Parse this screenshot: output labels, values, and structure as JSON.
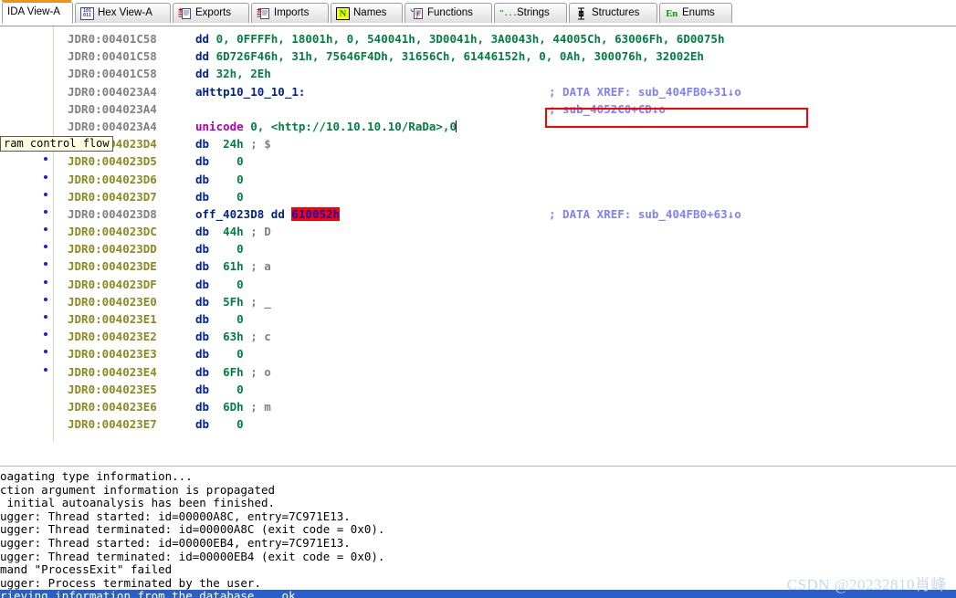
{
  "tabs": [
    {
      "label": "IDA View-A",
      "icon": "none",
      "active": true
    },
    {
      "label": "Hex View-A",
      "icon": "hex-grid-icon",
      "active": false
    },
    {
      "label": "Exports",
      "icon": "export-page-icon",
      "active": false
    },
    {
      "label": "Imports",
      "icon": "import-page-icon",
      "active": false
    },
    {
      "label": "Names",
      "icon": "names-n-icon",
      "active": false
    },
    {
      "label": "Functions",
      "icon": "functions-f-icon",
      "active": false
    },
    {
      "label": "Strings",
      "icon": "strings-quote-icon",
      "active": false
    },
    {
      "label": "Structures",
      "icon": "structures-icon",
      "active": false
    },
    {
      "label": "Enums",
      "icon": "enums-en-icon",
      "active": false
    }
  ],
  "tooltip": {
    "text": "ram control flow"
  },
  "disassembly": {
    "lines": [
      {
        "mark": false,
        "addr": "JDR0:00401C58",
        "addr_style": "gray",
        "segments": [
          {
            "t": "dd ",
            "c": "kw"
          },
          {
            "t": "0, 0FFFFh, 18001h, 0, 540041h, 3D0041h, 3A0043h, 44005Ch, 63006Fh, 6D0075h",
            "c": "num"
          }
        ],
        "xref": null
      },
      {
        "mark": false,
        "addr": "JDR0:00401C58",
        "addr_style": "gray",
        "segments": [
          {
            "t": "dd ",
            "c": "kw"
          },
          {
            "t": "6D726F46h, 31h, 75646F4Dh, 31656Ch, 61446152h, 0, 0Ah, 300076h, 32002Eh",
            "c": "num"
          }
        ],
        "xref": null
      },
      {
        "mark": false,
        "addr": "JDR0:00401C58",
        "addr_style": "gray",
        "segments": [
          {
            "t": "dd ",
            "c": "kw"
          },
          {
            "t": "32h, 2Eh",
            "c": "num"
          }
        ],
        "xref": null
      },
      {
        "mark": false,
        "addr": "JDR0:004023A4",
        "addr_style": "gray",
        "segments": [
          {
            "t": "aHttp10_10_10_1:",
            "c": "lbl"
          }
        ],
        "xref": "; DATA XREF: sub_404FB0+31↓o"
      },
      {
        "mark": false,
        "addr": "JDR0:004023A4",
        "addr_style": "gray",
        "segments": [],
        "xref": "; sub_4052C0+CD↓o"
      },
      {
        "mark": false,
        "addr": "JDR0:004023A4",
        "addr_style": "gray",
        "segments": [
          {
            "t": "unicode ",
            "c": "uni"
          },
          {
            "t": "0, <http://10.10.10.10/RaDa>,0",
            "c": "num"
          }
        ],
        "xref": null,
        "cursor": true
      },
      {
        "mark": true,
        "addr": "JDR0:004023D4",
        "addr_style": "olive",
        "segments": [
          {
            "t": "db  ",
            "c": "kw"
          },
          {
            "t": "24h",
            "c": "num"
          },
          {
            "t": " ; $",
            "c": "chr"
          }
        ],
        "xref": null
      },
      {
        "mark": true,
        "addr": "JDR0:004023D5",
        "addr_style": "olive",
        "segments": [
          {
            "t": "db    ",
            "c": "kw"
          },
          {
            "t": "0",
            "c": "num"
          }
        ],
        "xref": null
      },
      {
        "mark": true,
        "addr": "JDR0:004023D6",
        "addr_style": "olive",
        "segments": [
          {
            "t": "db    ",
            "c": "kw"
          },
          {
            "t": "0",
            "c": "num"
          }
        ],
        "xref": null
      },
      {
        "mark": true,
        "addr": "JDR0:004023D7",
        "addr_style": "olive",
        "segments": [
          {
            "t": "db    ",
            "c": "kw"
          },
          {
            "t": "0",
            "c": "num"
          }
        ],
        "xref": null
      },
      {
        "mark": true,
        "addr": "JDR0:004023D8",
        "addr_style": "gray",
        "segments": [
          {
            "t": "off_4023D8 ",
            "c": "lbl"
          },
          {
            "t": "dd ",
            "c": "kw"
          },
          {
            "t": "610052h",
            "c": "hlred"
          }
        ],
        "xref": "; DATA XREF: sub_404FB0+63↓o"
      },
      {
        "mark": true,
        "addr": "JDR0:004023DC",
        "addr_style": "olive",
        "segments": [
          {
            "t": "db  ",
            "c": "kw"
          },
          {
            "t": "44h",
            "c": "num"
          },
          {
            "t": " ; D",
            "c": "chr"
          }
        ],
        "xref": null
      },
      {
        "mark": true,
        "addr": "JDR0:004023DD",
        "addr_style": "olive",
        "segments": [
          {
            "t": "db    ",
            "c": "kw"
          },
          {
            "t": "0",
            "c": "num"
          }
        ],
        "xref": null
      },
      {
        "mark": true,
        "addr": "JDR0:004023DE",
        "addr_style": "olive",
        "segments": [
          {
            "t": "db  ",
            "c": "kw"
          },
          {
            "t": "61h",
            "c": "num"
          },
          {
            "t": " ; a",
            "c": "chr"
          }
        ],
        "xref": null
      },
      {
        "mark": true,
        "addr": "JDR0:004023DF",
        "addr_style": "olive",
        "segments": [
          {
            "t": "db    ",
            "c": "kw"
          },
          {
            "t": "0",
            "c": "num"
          }
        ],
        "xref": null
      },
      {
        "mark": true,
        "addr": "JDR0:004023E0",
        "addr_style": "olive",
        "segments": [
          {
            "t": "db  ",
            "c": "kw"
          },
          {
            "t": "5Fh",
            "c": "num"
          },
          {
            "t": " ; _",
            "c": "chr"
          }
        ],
        "xref": null
      },
      {
        "mark": true,
        "addr": "JDR0:004023E1",
        "addr_style": "olive",
        "segments": [
          {
            "t": "db    ",
            "c": "kw"
          },
          {
            "t": "0",
            "c": "num"
          }
        ],
        "xref": null
      },
      {
        "mark": true,
        "addr": "JDR0:004023E2",
        "addr_style": "olive",
        "segments": [
          {
            "t": "db  ",
            "c": "kw"
          },
          {
            "t": "63h",
            "c": "num"
          },
          {
            "t": " ; c",
            "c": "chr"
          }
        ],
        "xref": null
      },
      {
        "mark": true,
        "addr": "JDR0:004023E3",
        "addr_style": "olive",
        "segments": [
          {
            "t": "db    ",
            "c": "kw"
          },
          {
            "t": "0",
            "c": "num"
          }
        ],
        "xref": null
      },
      {
        "mark": true,
        "addr": "JDR0:004023E4",
        "addr_style": "olive",
        "segments": [
          {
            "t": "db  ",
            "c": "kw"
          },
          {
            "t": "6Fh",
            "c": "num"
          },
          {
            "t": " ; o",
            "c": "chr"
          }
        ],
        "xref": null
      },
      {
        "mark": false,
        "addr": "JDR0:004023E5",
        "addr_style": "olive",
        "segments": [
          {
            "t": "db    ",
            "c": "kw"
          },
          {
            "t": "0",
            "c": "num"
          }
        ],
        "xref": null
      },
      {
        "mark": false,
        "addr": "JDR0:004023E6",
        "addr_style": "olive",
        "segments": [
          {
            "t": "db  ",
            "c": "kw"
          },
          {
            "t": "6Dh",
            "c": "num"
          },
          {
            "t": " ; m",
            "c": "chr"
          }
        ],
        "xref": null
      },
      {
        "mark": false,
        "addr": "JDR0:004023E7",
        "addr_style": "olive",
        "segments": [
          {
            "t": "db    ",
            "c": "kw"
          },
          {
            "t": "0",
            "c": "num"
          }
        ],
        "xref": null
      }
    ]
  },
  "scrollbar": {
    "left_arrow": "◀",
    "grip": "‖‖"
  },
  "output": {
    "lines": [
      {
        "text": "oagating type information...",
        "selected": false
      },
      {
        "text": "ction argument information is propagated",
        "selected": false
      },
      {
        "text": " initial autoanalysis has been finished.",
        "selected": false
      },
      {
        "text": "ugger: Thread started: id=00000A8C, entry=7C971E13.",
        "selected": false
      },
      {
        "text": "ugger: Thread terminated: id=00000A8C (exit code = 0x0).",
        "selected": false
      },
      {
        "text": "ugger: Thread started: id=00000EB4, entry=7C971E13.",
        "selected": false
      },
      {
        "text": "ugger: Thread terminated: id=00000EB4 (exit code = 0x0).",
        "selected": false
      },
      {
        "text": "mand \"ProcessExit\" failed",
        "selected": false
      },
      {
        "text": "ugger: Process terminated by the user.",
        "selected": false
      },
      {
        "text": "rieving information from the database... ok",
        "selected": true
      }
    ]
  },
  "watermark": {
    "text": "CSDN @20232810肖峰"
  },
  "colors": {
    "accent_orange": "#ff9000",
    "keyword_blue": "#00238e",
    "number_green": "#008040",
    "comment_blue": "#8080ff",
    "unicode_magenta": "#b000b0",
    "highlight_red": "#ff0000",
    "selection_blue": "#2a5fc8",
    "address_gray": "#808080",
    "address_olive": "#8a8a1e"
  }
}
